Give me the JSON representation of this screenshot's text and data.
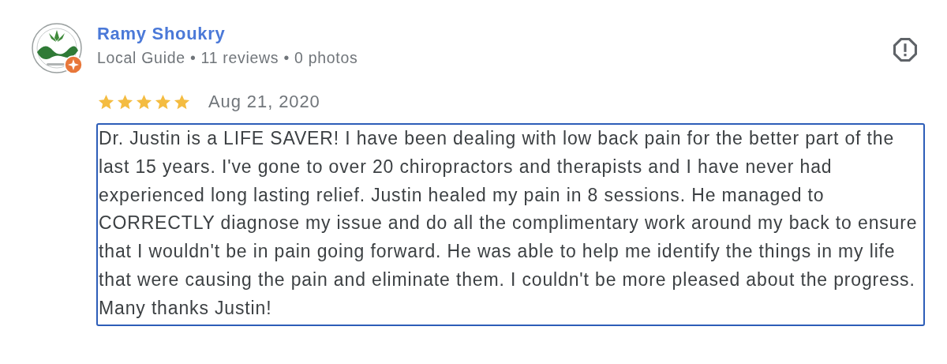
{
  "review": {
    "author": "Ramy Shoukry",
    "meta": "Local Guide • 11 reviews • 0 photos",
    "stars": 5,
    "date": "Aug 21, 2020",
    "text": "Dr. Justin is a LIFE SAVER! I have been dealing with low back pain for the better part of the last 15 years. I've gone to over 20 chiropractors and therapists and I have never had experienced long lasting relief. Justin healed my pain in 8 sessions. He managed to CORRECTLY diagnose my issue and do all the complimentary work around my back to ensure that I wouldn't be in pain going forward. He was able to help me identify the things in my life that were causing the pain and eliminate them. I couldn't be more pleased about the progress. Many thanks Justin!"
  }
}
